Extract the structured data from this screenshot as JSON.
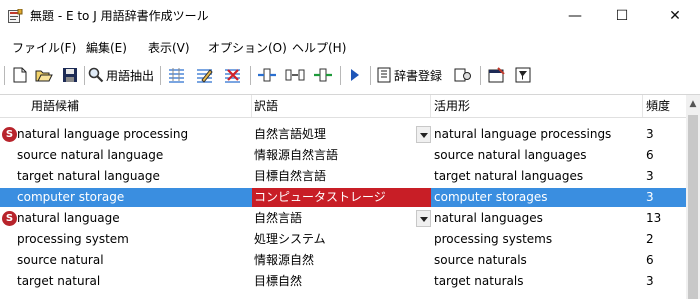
{
  "window": {
    "title": "無題 - E to J 用語辞書作成ツール",
    "min_glyph": "—",
    "max_glyph": "☐",
    "close_glyph": "✕"
  },
  "menu": {
    "items": [
      {
        "label": "ファイル(F)"
      },
      {
        "label": "編集(E)"
      },
      {
        "label": "表示(V)"
      },
      {
        "label": "オプション(O)"
      },
      {
        "label": "ヘルプ(H)"
      }
    ]
  },
  "toolbar": {
    "extract_label": "用語抽出",
    "register_label": "辞書登録"
  },
  "table": {
    "columns": [
      "用語候補",
      "訳語",
      "活用形",
      "頻度"
    ],
    "rows": [
      {
        "term": "natural language processing",
        "translation": "自然言語処理",
        "inflection": "natural language processings",
        "freq": "3",
        "badge": "S",
        "dropdown": true,
        "selected": false
      },
      {
        "term": "source natural language",
        "translation": "情報源自然言語",
        "inflection": "source natural languages",
        "freq": "6",
        "badge": "",
        "dropdown": false,
        "selected": false
      },
      {
        "term": "target natural language",
        "translation": "目標自然言語",
        "inflection": "target natural languages",
        "freq": "3",
        "badge": "",
        "dropdown": false,
        "selected": false
      },
      {
        "term": "computer storage",
        "translation": "コンピュータストレージ",
        "inflection": "computer storages",
        "freq": "3",
        "badge": "",
        "dropdown": false,
        "selected": true
      },
      {
        "term": "natural language",
        "translation": "自然言語",
        "inflection": "natural languages",
        "freq": "13",
        "badge": "S",
        "dropdown": true,
        "selected": false
      },
      {
        "term": "processing system",
        "translation": "処理システム",
        "inflection": "processing systems",
        "freq": "2",
        "badge": "",
        "dropdown": false,
        "selected": false
      },
      {
        "term": "source natural",
        "translation": "情報源自然",
        "inflection": "source naturals",
        "freq": "6",
        "badge": "",
        "dropdown": false,
        "selected": false
      },
      {
        "term": "target natural",
        "translation": "目標自然",
        "inflection": "target naturals",
        "freq": "3",
        "badge": "",
        "dropdown": false,
        "selected": false
      }
    ]
  },
  "colors": {
    "selection": "#3a8ee0",
    "selected_translation": "#c81e26",
    "badge": "#b8242c"
  }
}
